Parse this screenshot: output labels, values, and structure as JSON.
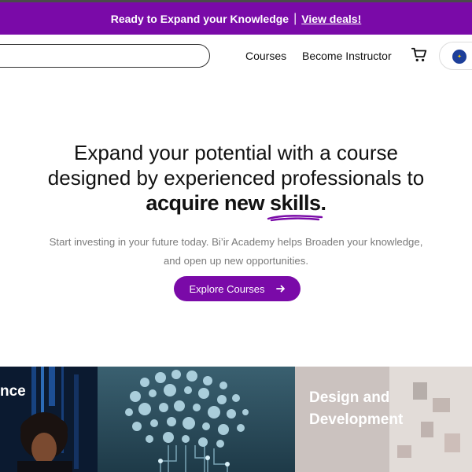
{
  "promo": {
    "text": "Ready to Expand your Knowledge",
    "separator": "|",
    "link": "View deals!"
  },
  "nav": {
    "search_placeholder": "",
    "courses": "Courses",
    "become_instructor": "Become Instructor"
  },
  "hero": {
    "line1": "Expand your potential with a course",
    "line2": "designed by experienced professionals to",
    "line3_prefix": "acquire new ",
    "line3_highlight": "skills",
    "line3_suffix": ".",
    "subtitle_line1": "Start investing in your future today. Bi’ir Academy helps Broaden your knowledge,",
    "subtitle_line2": "and open up new opportunities.",
    "cta_label": "Explore Courses"
  },
  "cards": [
    {
      "title": "nce"
    },
    {
      "title": ""
    },
    {
      "title": "Design and Development",
      "title_line1": "Design and",
      "title_line2": "Development"
    }
  ],
  "colors": {
    "brand": "#7a0aa8",
    "text": "#111111",
    "muted": "#7a7a7a"
  }
}
